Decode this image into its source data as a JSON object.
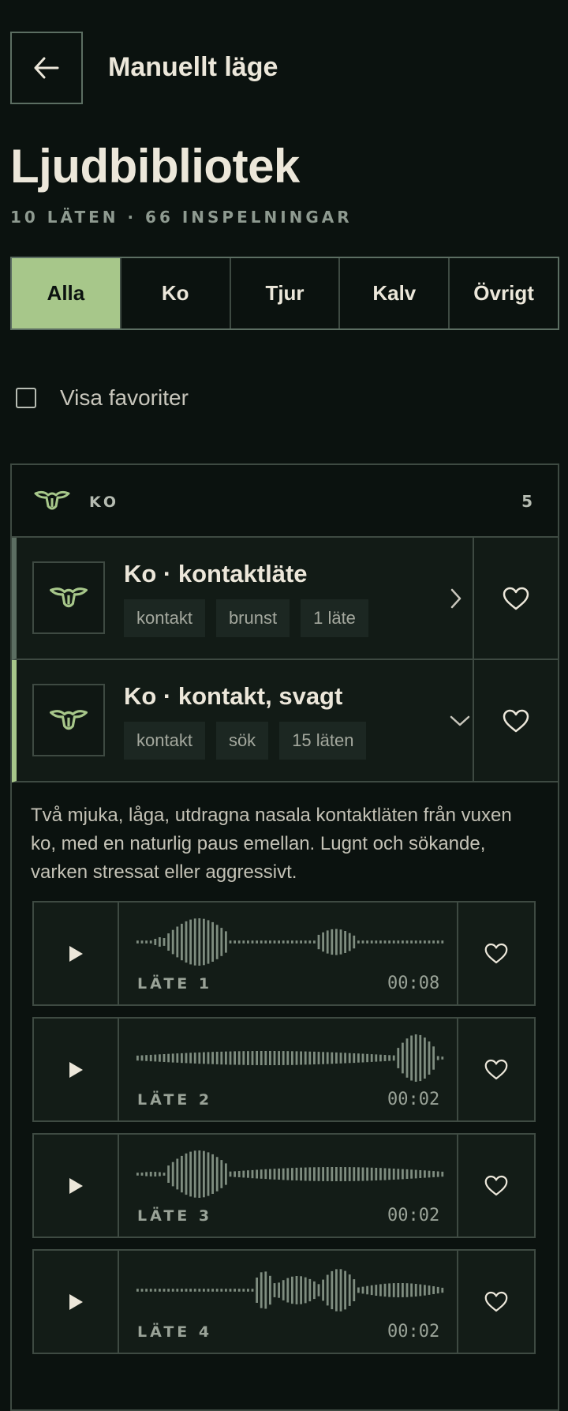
{
  "header": {
    "back_icon": "arrow-left-icon",
    "title": "Manuellt läge"
  },
  "page": {
    "title": "Ljudbibliotek",
    "subtitle": "10 LÄTEN · 66 INSPELNINGAR"
  },
  "tabs": [
    {
      "label": "Alla",
      "active": true
    },
    {
      "label": "Ko",
      "active": false
    },
    {
      "label": "Tjur",
      "active": false
    },
    {
      "label": "Kalv",
      "active": false
    },
    {
      "label": "Övrigt",
      "active": false
    }
  ],
  "favorites_toggle": {
    "label": "Visa favoriter",
    "checked": false
  },
  "group": {
    "icon": "cow-head-icon",
    "label": "KO",
    "count": "5",
    "sounds": [
      {
        "title": "Ko · kontaktläte",
        "tags": [
          "kontakt",
          "brunst",
          "1 läte"
        ],
        "expanded": false,
        "chevron": "chevron-right-icon"
      },
      {
        "title": "Ko · kontakt, svagt",
        "tags": [
          "kontakt",
          "sök",
          "15 läten"
        ],
        "expanded": true,
        "chevron": "chevron-down-icon"
      }
    ],
    "description": "Två mjuka, låga, utdragna nasala kontaktläten från vuxen ko, med en naturlig paus emellan. Lugnt och sökande, varken stressat eller aggressivt.",
    "recordings": [
      {
        "label": "LÄTE 1",
        "duration": "00:08"
      },
      {
        "label": "LÄTE 2",
        "duration": "00:02"
      },
      {
        "label": "LÄTE 3",
        "duration": "00:02"
      },
      {
        "label": "LÄTE 4",
        "duration": "00:02"
      }
    ]
  },
  "colors": {
    "background": "#0b120f",
    "accent": "#a7c78a",
    "border": "#3e4a42",
    "text": "#ece7da"
  }
}
